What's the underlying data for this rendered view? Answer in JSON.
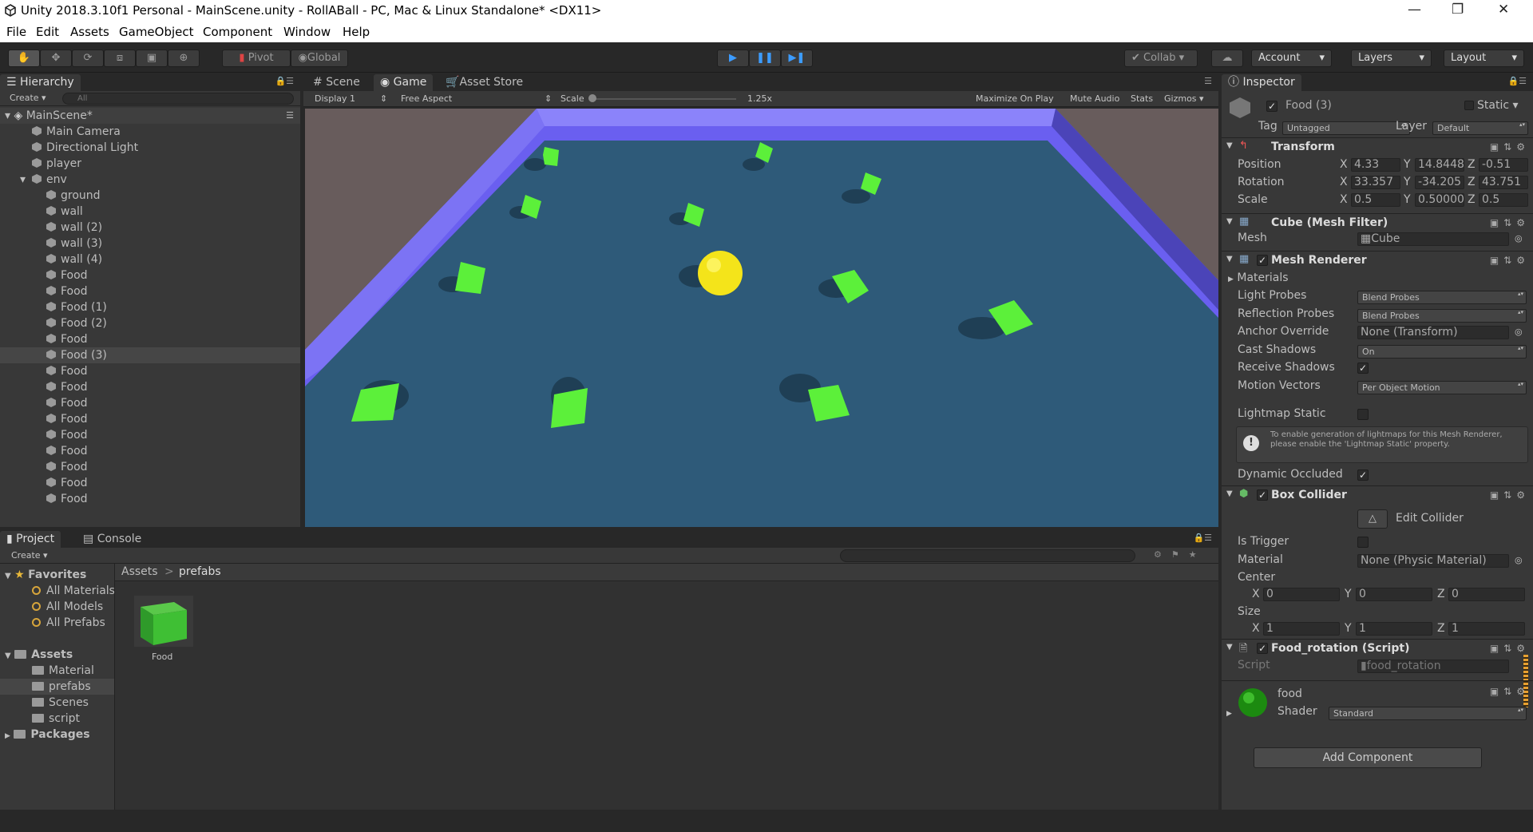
{
  "window": {
    "title": "Unity 2018.3.10f1 Personal - MainScene.unity - RollABall - PC, Mac & Linux Standalone* <DX11>",
    "minimize": "—",
    "maximize": "❐",
    "close": "✕"
  },
  "menu": [
    "File",
    "Edit",
    "Assets",
    "GameObject",
    "Component",
    "Window",
    "Help"
  ],
  "toolbar": {
    "pivot": "Pivot",
    "global": "Global",
    "collab": "Collab",
    "account": "Account",
    "layers": "Layers",
    "layout": "Layout"
  },
  "hierarchy": {
    "tab": "Hierarchy",
    "create": "Create",
    "search_placeholder": "All",
    "scene": "MainScene*",
    "items": [
      {
        "label": "Main Camera",
        "indent": 1
      },
      {
        "label": "Directional Light",
        "indent": 1
      },
      {
        "label": "player",
        "indent": 1
      },
      {
        "label": "env",
        "indent": 1
      },
      {
        "label": "ground",
        "indent": 2
      },
      {
        "label": "wall",
        "indent": 2
      },
      {
        "label": "wall (2)",
        "indent": 2
      },
      {
        "label": "wall (3)",
        "indent": 2
      },
      {
        "label": "wall (4)",
        "indent": 2
      },
      {
        "label": "Food",
        "indent": 2
      },
      {
        "label": "Food",
        "indent": 2
      },
      {
        "label": "Food (1)",
        "indent": 2
      },
      {
        "label": "Food (2)",
        "indent": 2
      },
      {
        "label": "Food",
        "indent": 2
      },
      {
        "label": "Food (3)",
        "indent": 2,
        "selected": true
      },
      {
        "label": "Food",
        "indent": 2
      },
      {
        "label": "Food",
        "indent": 2
      },
      {
        "label": "Food",
        "indent": 2
      },
      {
        "label": "Food",
        "indent": 2
      },
      {
        "label": "Food",
        "indent": 2
      },
      {
        "label": "Food",
        "indent": 2
      },
      {
        "label": "Food",
        "indent": 2
      },
      {
        "label": "Food",
        "indent": 2
      },
      {
        "label": "Food",
        "indent": 2
      }
    ]
  },
  "view": {
    "tabs": {
      "scene": "Scene",
      "game": "Game",
      "asset_store": "Asset Store"
    },
    "display": "Display 1",
    "aspect": "Free Aspect",
    "scale_label": "Scale",
    "scale_value": "1.25x",
    "maximize": "Maximize On Play",
    "mute": "Mute Audio",
    "stats": "Stats",
    "gizmos": "Gizmos"
  },
  "project": {
    "tabs": {
      "project": "Project",
      "console": "Console"
    },
    "create": "Create",
    "favorites": "Favorites",
    "favorite_items": [
      "All Materials",
      "All Models",
      "All Prefabs"
    ],
    "assets": "Assets",
    "asset_folders": [
      "Material",
      "prefabs",
      "Scenes",
      "script"
    ],
    "packages": "Packages",
    "breadcrumb": {
      "root": "Assets",
      "sep": ">",
      "current": "prefabs"
    },
    "asset_item": "Food"
  },
  "inspector": {
    "tab": "Inspector",
    "object_name": "Food (3)",
    "static_label": "Static",
    "tag_label": "Tag",
    "tag": "Untagged",
    "layer_label": "Layer",
    "layer": "Default",
    "transform": {
      "title": "Transform",
      "position": {
        "label": "Position",
        "x": "4.33",
        "y": "14.8448",
        "z": "-0.51"
      },
      "rotation": {
        "label": "Rotation",
        "x": "33.357",
        "y": "-34.205",
        "z": "43.751"
      },
      "scale": {
        "label": "Scale",
        "x": "0.5",
        "y": "0.50000",
        "z": "0.5"
      }
    },
    "mesh_filter": {
      "title": "Cube (Mesh Filter)",
      "mesh_label": "Mesh",
      "mesh": "Cube"
    },
    "mesh_renderer": {
      "title": "Mesh Renderer",
      "materials": "Materials",
      "light_probes_label": "Light Probes",
      "light_probes": "Blend Probes",
      "reflection_label": "Reflection Probes",
      "reflection": "Blend Probes",
      "anchor_label": "Anchor Override",
      "anchor": "None (Transform)",
      "cast_label": "Cast Shadows",
      "cast": "On",
      "receive_label": "Receive Shadows",
      "motion_label": "Motion Vectors",
      "motion": "Per Object Motion",
      "lightmap_label": "Lightmap Static",
      "info": "To enable generation of lightmaps for this Mesh Renderer, please enable the 'Lightmap Static' property.",
      "occluded_label": "Dynamic Occluded"
    },
    "box_collider": {
      "title": "Box Collider",
      "edit": "Edit Collider",
      "trigger_label": "Is Trigger",
      "material_label": "Material",
      "material": "None (Physic Material)",
      "center_label": "Center",
      "center": {
        "x": "0",
        "y": "0",
        "z": "0"
      },
      "size_label": "Size",
      "size": {
        "x": "1",
        "y": "1",
        "z": "1"
      }
    },
    "script": {
      "title": "Food_rotation (Script)",
      "script_label": "Script",
      "script": "food_rotation"
    },
    "material": {
      "name": "food",
      "shader_label": "Shader",
      "shader": "Standard"
    },
    "add_component": "Add Component"
  },
  "colors": {
    "accent": "#3c74c0",
    "food": "#5cf03a",
    "player": "#f4e41a",
    "wall": "#6f63e6",
    "ground": "#2f5a78"
  }
}
